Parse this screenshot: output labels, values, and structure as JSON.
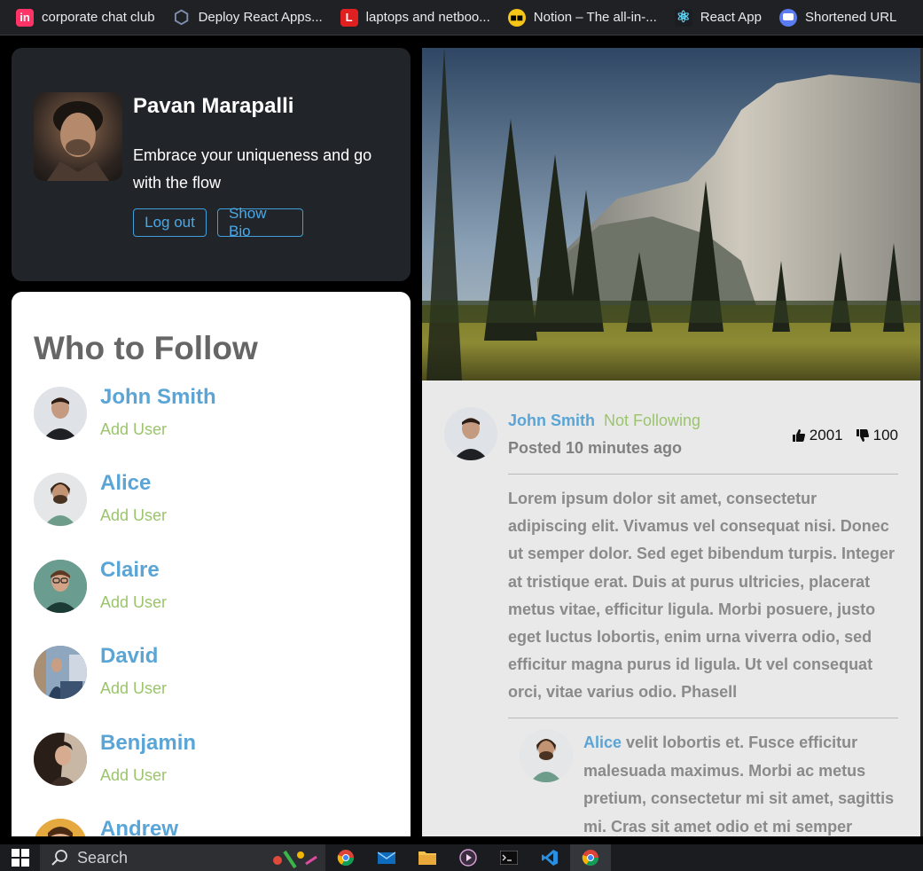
{
  "bookmarks": [
    {
      "label": "corporate chat club",
      "icon": "invision-icon",
      "color": "#ff3366",
      "glyph": "in"
    },
    {
      "label": "Deploy React Apps...",
      "icon": "hexagon-icon",
      "color": "#5b6b8c",
      "glyph": "⬡"
    },
    {
      "label": "laptops and netboo...",
      "icon": "l-logo-icon",
      "color": "#e02020",
      "glyph": "L"
    },
    {
      "label": "Notion – The all-in-...",
      "icon": "sunglasses-emoji-icon",
      "color": "#f5c518",
      "glyph": "😎"
    },
    {
      "label": "React App",
      "icon": "react-icon",
      "color": "#1b1d22",
      "glyph": "⚛"
    },
    {
      "label": "Shortened URL",
      "icon": "chat-bubble-icon",
      "color": "#5b7cf0",
      "glyph": "▣"
    }
  ],
  "profile": {
    "name": "Pavan Marapalli",
    "bio": "Embrace your uniqueness and go with the flow",
    "logout_label": "Log out",
    "show_bio_label": "Show Bio"
  },
  "follow": {
    "title": "Who to Follow",
    "add_label": "Add User",
    "users": [
      {
        "name": "John Smith"
      },
      {
        "name": "Alice"
      },
      {
        "name": "Claire"
      },
      {
        "name": "David"
      },
      {
        "name": "Benjamin"
      },
      {
        "name": "Andrew"
      }
    ]
  },
  "post": {
    "author": "John Smith",
    "follow_status": "Not Following",
    "time": "Posted 10 minutes ago",
    "likes": "2001",
    "dislikes": "100",
    "body": "Lorem ipsum dolor sit amet, consectetur adipiscing elit. Vivamus vel consequat nisi. Donec ut semper dolor. Sed eget bibendum turpis. Integer at tristique erat. Duis at purus ultricies, placerat metus vitae, efficitur ligula. Morbi posuere, justo eget luctus lobortis, enim urna viverra odio, sed efficitur magna purus id ligula. Ut vel consequat orci, vitae varius odio. Phasell",
    "comment": {
      "author": "Alice",
      "text": "velit lobortis et. Fusce efficitur malesuada maximus. Morbi ac metus pretium, consectetur mi sit amet, sagittis mi. Cras sit amet odio et mi semper"
    }
  },
  "taskbar": {
    "search_label": "Search",
    "apps": [
      "chrome-icon",
      "mail-icon",
      "file-explorer-icon",
      "media-player-icon",
      "terminal-icon",
      "vscode-icon",
      "chrome-active-icon"
    ]
  },
  "colors": {
    "accent_blue": "#5aa5d6",
    "accent_green": "#9bc46d",
    "card_dark": "#212529",
    "post_bg": "#e9e9e9"
  }
}
